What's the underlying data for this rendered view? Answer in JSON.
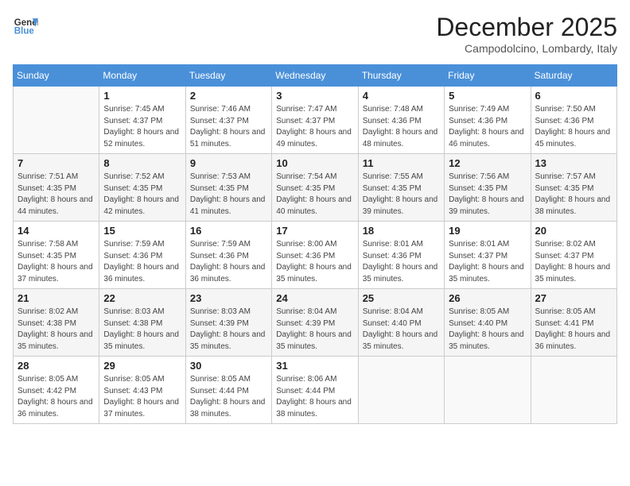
{
  "header": {
    "logo_line1": "General",
    "logo_line2": "Blue",
    "month_year": "December 2025",
    "location": "Campodolcino, Lombardy, Italy"
  },
  "weekdays": [
    "Sunday",
    "Monday",
    "Tuesday",
    "Wednesday",
    "Thursday",
    "Friday",
    "Saturday"
  ],
  "weeks": [
    [
      {
        "day": "",
        "empty": true
      },
      {
        "day": "1",
        "sunrise": "7:45 AM",
        "sunset": "4:37 PM",
        "daylight": "8 hours and 52 minutes."
      },
      {
        "day": "2",
        "sunrise": "7:46 AM",
        "sunset": "4:37 PM",
        "daylight": "8 hours and 51 minutes."
      },
      {
        "day": "3",
        "sunrise": "7:47 AM",
        "sunset": "4:37 PM",
        "daylight": "8 hours and 49 minutes."
      },
      {
        "day": "4",
        "sunrise": "7:48 AM",
        "sunset": "4:36 PM",
        "daylight": "8 hours and 48 minutes."
      },
      {
        "day": "5",
        "sunrise": "7:49 AM",
        "sunset": "4:36 PM",
        "daylight": "8 hours and 46 minutes."
      },
      {
        "day": "6",
        "sunrise": "7:50 AM",
        "sunset": "4:36 PM",
        "daylight": "8 hours and 45 minutes."
      }
    ],
    [
      {
        "day": "7",
        "sunrise": "7:51 AM",
        "sunset": "4:35 PM",
        "daylight": "8 hours and 44 minutes."
      },
      {
        "day": "8",
        "sunrise": "7:52 AM",
        "sunset": "4:35 PM",
        "daylight": "8 hours and 42 minutes."
      },
      {
        "day": "9",
        "sunrise": "7:53 AM",
        "sunset": "4:35 PM",
        "daylight": "8 hours and 41 minutes."
      },
      {
        "day": "10",
        "sunrise": "7:54 AM",
        "sunset": "4:35 PM",
        "daylight": "8 hours and 40 minutes."
      },
      {
        "day": "11",
        "sunrise": "7:55 AM",
        "sunset": "4:35 PM",
        "daylight": "8 hours and 39 minutes."
      },
      {
        "day": "12",
        "sunrise": "7:56 AM",
        "sunset": "4:35 PM",
        "daylight": "8 hours and 39 minutes."
      },
      {
        "day": "13",
        "sunrise": "7:57 AM",
        "sunset": "4:35 PM",
        "daylight": "8 hours and 38 minutes."
      }
    ],
    [
      {
        "day": "14",
        "sunrise": "7:58 AM",
        "sunset": "4:35 PM",
        "daylight": "8 hours and 37 minutes."
      },
      {
        "day": "15",
        "sunrise": "7:59 AM",
        "sunset": "4:36 PM",
        "daylight": "8 hours and 36 minutes."
      },
      {
        "day": "16",
        "sunrise": "7:59 AM",
        "sunset": "4:36 PM",
        "daylight": "8 hours and 36 minutes."
      },
      {
        "day": "17",
        "sunrise": "8:00 AM",
        "sunset": "4:36 PM",
        "daylight": "8 hours and 35 minutes."
      },
      {
        "day": "18",
        "sunrise": "8:01 AM",
        "sunset": "4:36 PM",
        "daylight": "8 hours and 35 minutes."
      },
      {
        "day": "19",
        "sunrise": "8:01 AM",
        "sunset": "4:37 PM",
        "daylight": "8 hours and 35 minutes."
      },
      {
        "day": "20",
        "sunrise": "8:02 AM",
        "sunset": "4:37 PM",
        "daylight": "8 hours and 35 minutes."
      }
    ],
    [
      {
        "day": "21",
        "sunrise": "8:02 AM",
        "sunset": "4:38 PM",
        "daylight": "8 hours and 35 minutes."
      },
      {
        "day": "22",
        "sunrise": "8:03 AM",
        "sunset": "4:38 PM",
        "daylight": "8 hours and 35 minutes."
      },
      {
        "day": "23",
        "sunrise": "8:03 AM",
        "sunset": "4:39 PM",
        "daylight": "8 hours and 35 minutes."
      },
      {
        "day": "24",
        "sunrise": "8:04 AM",
        "sunset": "4:39 PM",
        "daylight": "8 hours and 35 minutes."
      },
      {
        "day": "25",
        "sunrise": "8:04 AM",
        "sunset": "4:40 PM",
        "daylight": "8 hours and 35 minutes."
      },
      {
        "day": "26",
        "sunrise": "8:05 AM",
        "sunset": "4:40 PM",
        "daylight": "8 hours and 35 minutes."
      },
      {
        "day": "27",
        "sunrise": "8:05 AM",
        "sunset": "4:41 PM",
        "daylight": "8 hours and 36 minutes."
      }
    ],
    [
      {
        "day": "28",
        "sunrise": "8:05 AM",
        "sunset": "4:42 PM",
        "daylight": "8 hours and 36 minutes."
      },
      {
        "day": "29",
        "sunrise": "8:05 AM",
        "sunset": "4:43 PM",
        "daylight": "8 hours and 37 minutes."
      },
      {
        "day": "30",
        "sunrise": "8:05 AM",
        "sunset": "4:44 PM",
        "daylight": "8 hours and 38 minutes."
      },
      {
        "day": "31",
        "sunrise": "8:06 AM",
        "sunset": "4:44 PM",
        "daylight": "8 hours and 38 minutes."
      },
      {
        "day": "",
        "empty": true
      },
      {
        "day": "",
        "empty": true
      },
      {
        "day": "",
        "empty": true
      }
    ]
  ]
}
